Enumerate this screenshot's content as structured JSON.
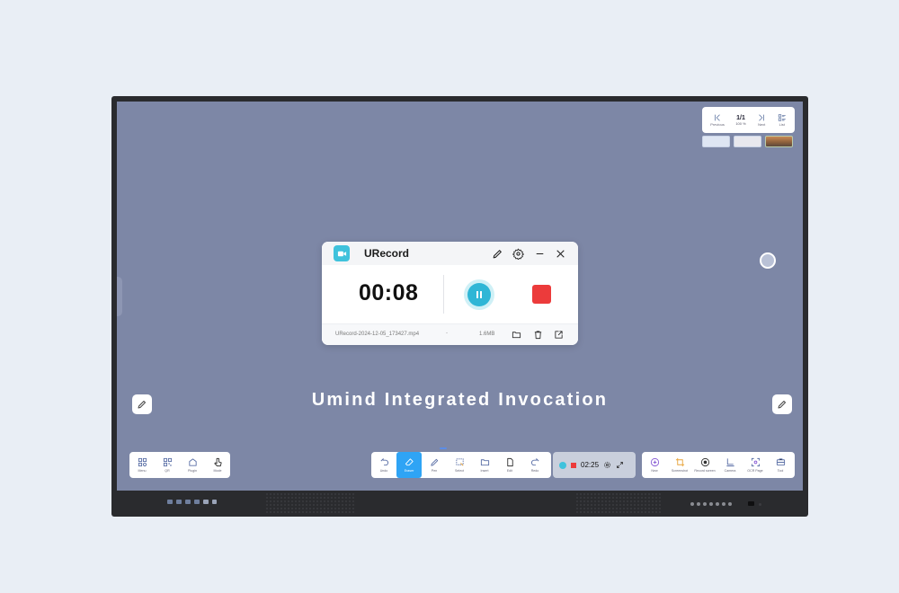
{
  "recorder": {
    "title": "URecord",
    "timer": "00:08",
    "file_name": "URecord-2024-12-05_173427.mp4",
    "divider": "-",
    "file_size": "1.6MB",
    "accent": "#3fc2dc",
    "stop_color": "#ec3b3b"
  },
  "page_nav": {
    "prev_label": "Previous",
    "count": "1/1",
    "zoom": "100 %",
    "next_label": "Next",
    "list_label": "List"
  },
  "caption": "Umind Integrated Invocation",
  "left_toolbar": [
    {
      "label": "Menu",
      "icon": "menu-icon"
    },
    {
      "label": "QR",
      "icon": "qr-icon"
    },
    {
      "label": "Plugin",
      "icon": "plugin-icon"
    },
    {
      "label": "Mode",
      "icon": "pointer-icon"
    }
  ],
  "center_toolbar": [
    {
      "label": "Undo",
      "icon": "undo-icon"
    },
    {
      "label": "Eraser",
      "icon": "eraser-icon",
      "active": true
    },
    {
      "label": "Pen",
      "icon": "pen-icon"
    },
    {
      "label": "Select",
      "icon": "select-icon"
    },
    {
      "label": "Insert",
      "icon": "folder-icon"
    },
    {
      "label": "Edit",
      "icon": "file-icon"
    },
    {
      "label": "Redo",
      "icon": "redo-icon"
    }
  ],
  "mini_recorder": {
    "time": "02:25"
  },
  "right_toolbar": [
    {
      "label": "New",
      "icon": "new-icon"
    },
    {
      "label": "Screenshot",
      "icon": "crop-icon"
    },
    {
      "label": "Record screen",
      "icon": "record-icon"
    },
    {
      "label": "Camera",
      "icon": "camera-icon"
    },
    {
      "label": "OCR Page",
      "icon": "ocr-icon"
    },
    {
      "label": "Tool",
      "icon": "toolbox-icon"
    }
  ],
  "active_color": "#2fa4f5"
}
